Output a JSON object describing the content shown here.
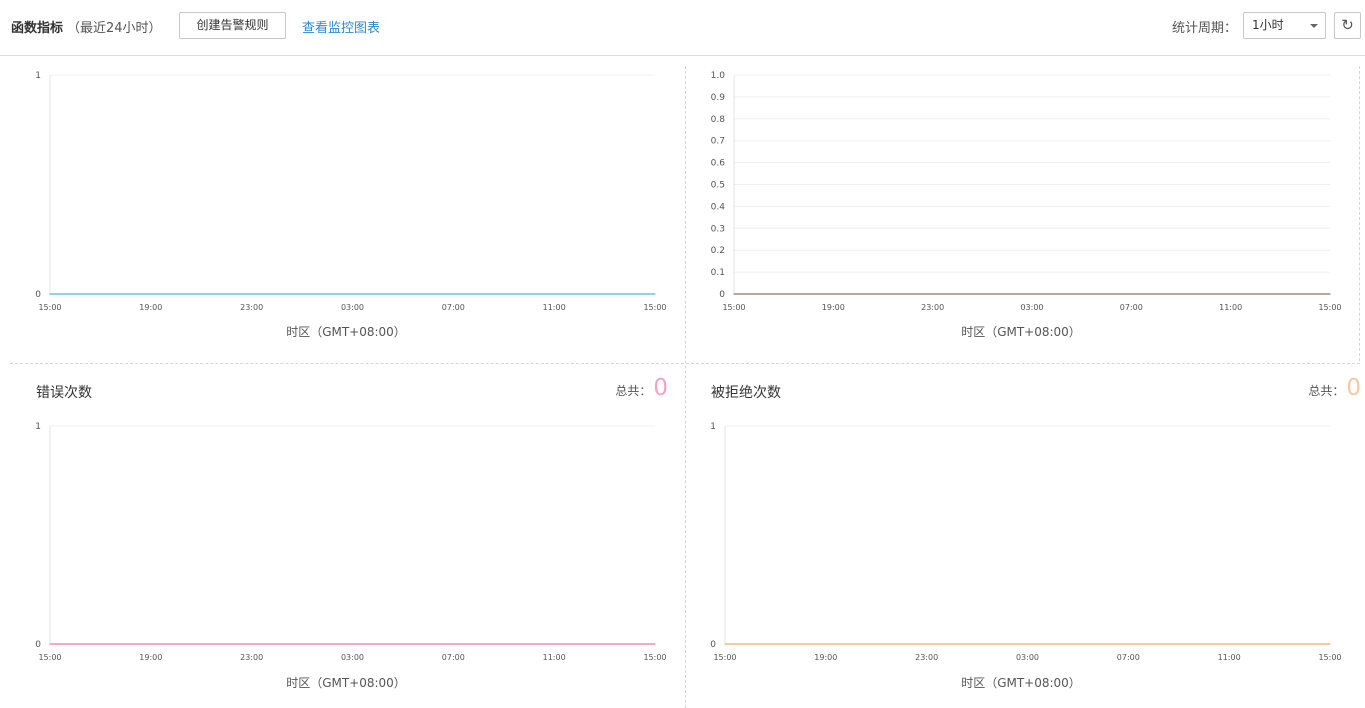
{
  "header": {
    "title": "函数指标",
    "subtitle": "（最近24小时）",
    "create_alarm_label": "创建告警规则",
    "view_monitor_label": "查看监控图表",
    "period_label": "统计周期：",
    "period_value": "1小时",
    "refresh_icon": "refresh-icon"
  },
  "panels": [
    {
      "title": "",
      "total_label": "",
      "total_value": "",
      "xlabel": "时区（GMT+08:00）"
    },
    {
      "title": "",
      "total_label": "",
      "total_value": "",
      "xlabel": "时区（GMT+08:00）"
    },
    {
      "title": "错误次数",
      "total_label": "总共：",
      "total_value": "0",
      "xlabel": "时区（GMT+08:00）"
    },
    {
      "title": "被拒绝次数",
      "total_label": "总共：",
      "total_value": "0",
      "xlabel": "时区（GMT+08:00）"
    }
  ],
  "chart_data": [
    {
      "type": "line",
      "x": [
        "15:00",
        "19:00",
        "23:00",
        "03:00",
        "07:00",
        "11:00",
        "15:00"
      ],
      "series": [
        {
          "values": [
            0,
            0,
            0,
            0,
            0,
            0,
            0
          ],
          "color": "#8fd3e6"
        }
      ],
      "yticks": [
        "0",
        "1"
      ],
      "ylim": [
        0,
        1
      ],
      "xlabel": "时区（GMT+08:00）"
    },
    {
      "type": "line",
      "x": [
        "15:00",
        "19:00",
        "23:00",
        "03:00",
        "07:00",
        "11:00",
        "15:00"
      ],
      "series": [
        {
          "values": [
            0,
            0,
            0,
            0,
            0,
            0,
            0
          ],
          "color": "#b6ab9a"
        }
      ],
      "yticks": [
        "0",
        "0.1",
        "0.2",
        "0.3",
        "0.4",
        "0.5",
        "0.6",
        "0.7",
        "0.8",
        "0.9",
        "1.0"
      ],
      "ylim": [
        0,
        1
      ],
      "xlabel": "时区（GMT+08:00）"
    },
    {
      "type": "line",
      "title": "错误次数",
      "x": [
        "15:00",
        "19:00",
        "23:00",
        "03:00",
        "07:00",
        "11:00",
        "15:00"
      ],
      "series": [
        {
          "values": [
            0,
            0,
            0,
            0,
            0,
            0,
            0
          ],
          "color": "#f3a9cf"
        }
      ],
      "yticks": [
        "0",
        "1"
      ],
      "ylim": [
        0,
        1
      ],
      "xlabel": "时区（GMT+08:00）"
    },
    {
      "type": "line",
      "title": "被拒绝次数",
      "x": [
        "15:00",
        "19:00",
        "23:00",
        "03:00",
        "07:00",
        "11:00",
        "15:00"
      ],
      "series": [
        {
          "values": [
            0,
            0,
            0,
            0,
            0,
            0,
            0
          ],
          "color": "#f5c9a2"
        }
      ],
      "yticks": [
        "0",
        "1"
      ],
      "ylim": [
        0,
        1
      ],
      "xlabel": "时区（GMT+08:00）"
    }
  ],
  "colors": {
    "link": "#2a8ad4",
    "error_total": "#f3a3c4",
    "reject_total": "#f5c9a2"
  }
}
